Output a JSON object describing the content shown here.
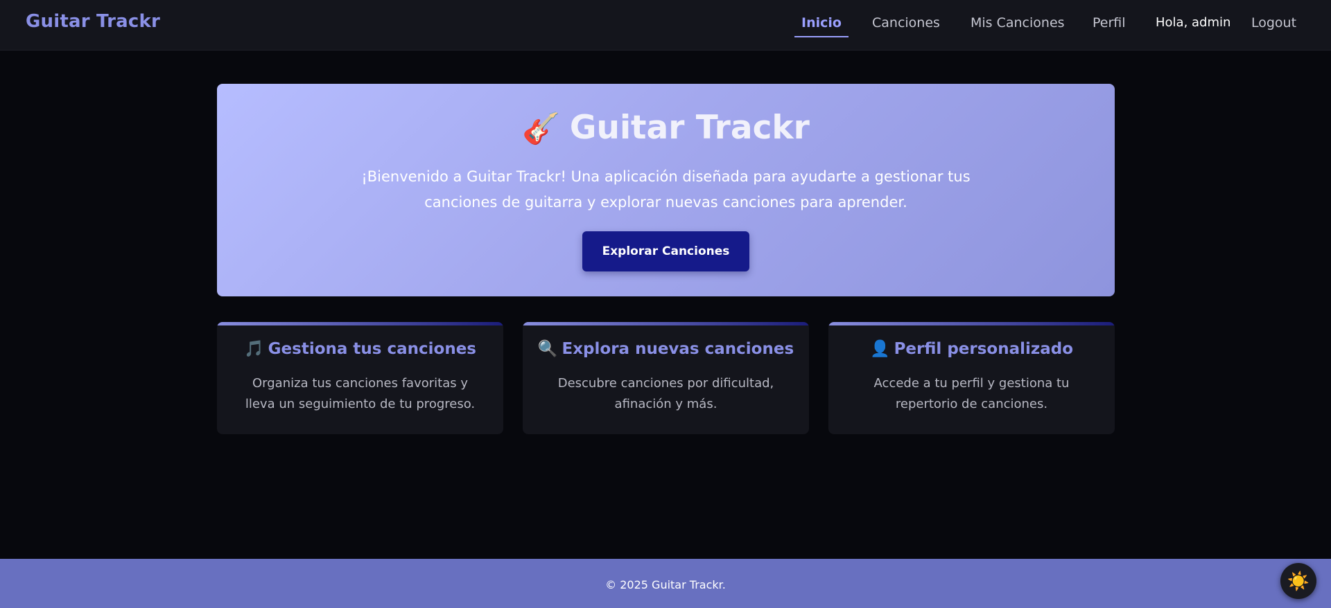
{
  "navbar": {
    "brand": "Guitar Trackr",
    "links": [
      {
        "label": "Inicio",
        "active": true
      },
      {
        "label": "Canciones",
        "active": false
      },
      {
        "label": "Mis Canciones",
        "active": false
      },
      {
        "label": "Perfil",
        "active": false
      }
    ],
    "greeting": "Hola, admin",
    "logout": "Logout"
  },
  "hero": {
    "icon": "🎸",
    "title": "Guitar Trackr",
    "text": "¡Bienvenido a Guitar Trackr! Una aplicación diseñada para ayudarte a gestionar tus canciones de guitarra y explorar nuevas canciones para aprender.",
    "button": "Explorar Canciones"
  },
  "features": [
    {
      "icon": "🎵",
      "title": "Gestiona tus canciones",
      "text": "Organiza tus canciones favoritas y lleva un seguimiento de tu progreso."
    },
    {
      "icon": "🔍",
      "title": "Explora nuevas canciones",
      "text": "Descubre canciones por dificultad, afinación y más."
    },
    {
      "icon": "👤",
      "title": "Perfil personalizado",
      "text": "Accede a tu perfil y gestiona tu repertorio de canciones."
    }
  ],
  "footer": {
    "text": "© 2025 Guitar Trackr."
  },
  "theme_toggle": {
    "icon": "☀️"
  },
  "colors": {
    "accent": "#8a90e6",
    "active_link": "#9ba0ff",
    "button": "#151a8a",
    "footer": "#6870c0",
    "background": "#07080d"
  }
}
